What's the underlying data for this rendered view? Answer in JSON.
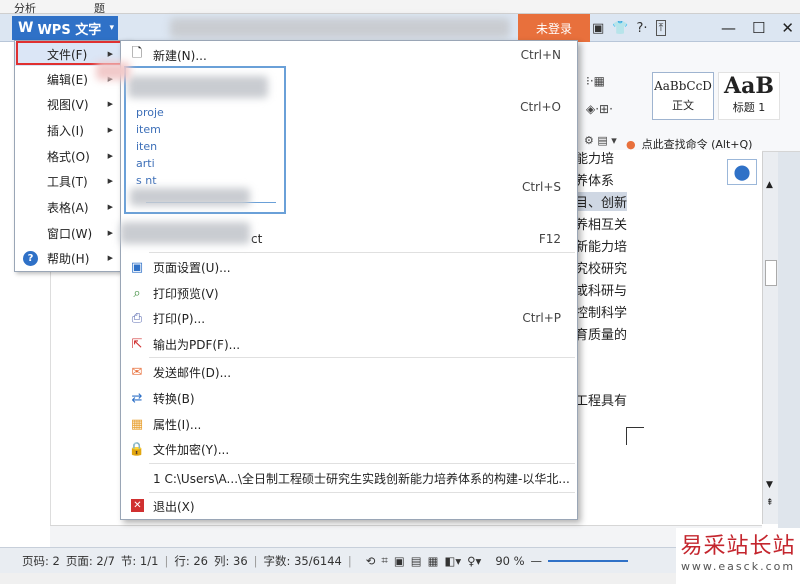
{
  "top_strip": {
    "left": "分析",
    "right": "题"
  },
  "app": {
    "logo_text": "W",
    "name": "WPS 文字",
    "login_label": "未登录"
  },
  "window_controls": [
    "▣",
    "👕",
    "?·",
    "⊡",
    "—",
    "☐",
    "✕"
  ],
  "ribbon": {
    "styles": [
      {
        "sample": "AaBbCcD",
        "label": "正文"
      },
      {
        "sample": "AaB",
        "label": "标题 1"
      }
    ],
    "find_command": "点此查找命令 (Alt+Q)"
  },
  "main_menu": {
    "items": [
      {
        "label": "文件(F)",
        "has_arrow": true
      },
      {
        "label": "编辑(E)",
        "has_arrow": true
      },
      {
        "label": "视图(V)",
        "has_arrow": true
      },
      {
        "label": "插入(I)",
        "has_arrow": true
      },
      {
        "label": "格式(O)",
        "has_arrow": true
      },
      {
        "label": "工具(T)",
        "has_arrow": true
      },
      {
        "label": "表格(A)",
        "has_arrow": true
      },
      {
        "label": "窗口(W)",
        "has_arrow": true
      },
      {
        "label": "帮助(H)",
        "has_arrow": true
      }
    ]
  },
  "file_menu": {
    "new": {
      "label": "新建(N)...",
      "shortcut": "Ctrl+N"
    },
    "open_shortcut": "Ctrl+O",
    "save_shortcut": "Ctrl+S",
    "saveas_shortcut": "F12",
    "saveas_tail": "ct",
    "recent_preview": [
      "proje",
      "item",
      "iten",
      "arti",
      "s             nt"
    ],
    "page_setup": "页面设置(U)...",
    "print_preview": "打印预览(V)",
    "print": {
      "label": "打印(P)...",
      "shortcut": "Ctrl+P"
    },
    "export_pdf": "输出为PDF(F)...",
    "send_mail": "发送邮件(D)...",
    "convert": "转换(B)",
    "properties": "属性(I)...",
    "encrypt": "文件加密(Y)...",
    "recent_file": "1 C:\\Users\\A...\\全日制工程硕士研究生实践创新能力培养体系的构建-以华北...",
    "exit": "退出(X)"
  },
  "document": {
    "lines": [
      "能力培",
      "养体系",
      "目、创新",
      "养相互关",
      "新能力培",
      "究校研究",
      "或科研与",
      "控制科学",
      "育质量的",
      "工程具有"
    ]
  },
  "status_bar": {
    "page_no": "页码: 2",
    "pages": "页面: 2/7",
    "section": "节: 1/1",
    "row": "行: 26",
    "col": "列: 36",
    "words": "字数: 35/6144",
    "zoom": "90 %"
  },
  "watermark": {
    "big": "易采站长站",
    "small": "www.easck.com"
  }
}
